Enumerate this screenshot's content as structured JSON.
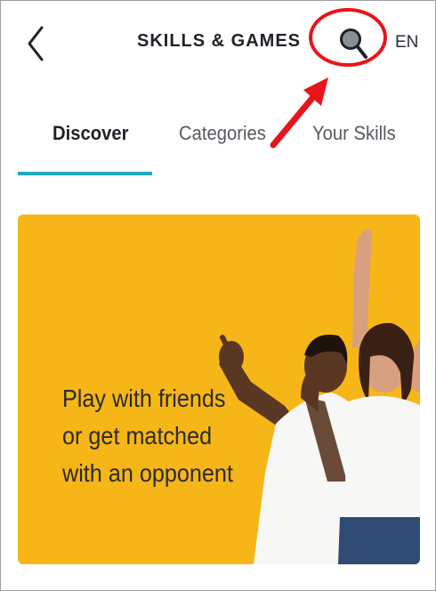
{
  "header": {
    "title": "SKILLS & GAMES",
    "language": "EN",
    "back_icon": "chevron-left-icon",
    "search_icon": "search-icon"
  },
  "annotation": {
    "highlight_color": "#e8141c"
  },
  "tabs": [
    {
      "label": "Discover",
      "active": true
    },
    {
      "label": "Categories",
      "active": false
    },
    {
      "label": "Your Skills",
      "active": false
    }
  ],
  "colors": {
    "accent": "#1ea7c7",
    "banner_bg": "#f7b617"
  },
  "banner": {
    "lines": [
      "Play with friends",
      "or get matched",
      "with an opponent"
    ]
  }
}
